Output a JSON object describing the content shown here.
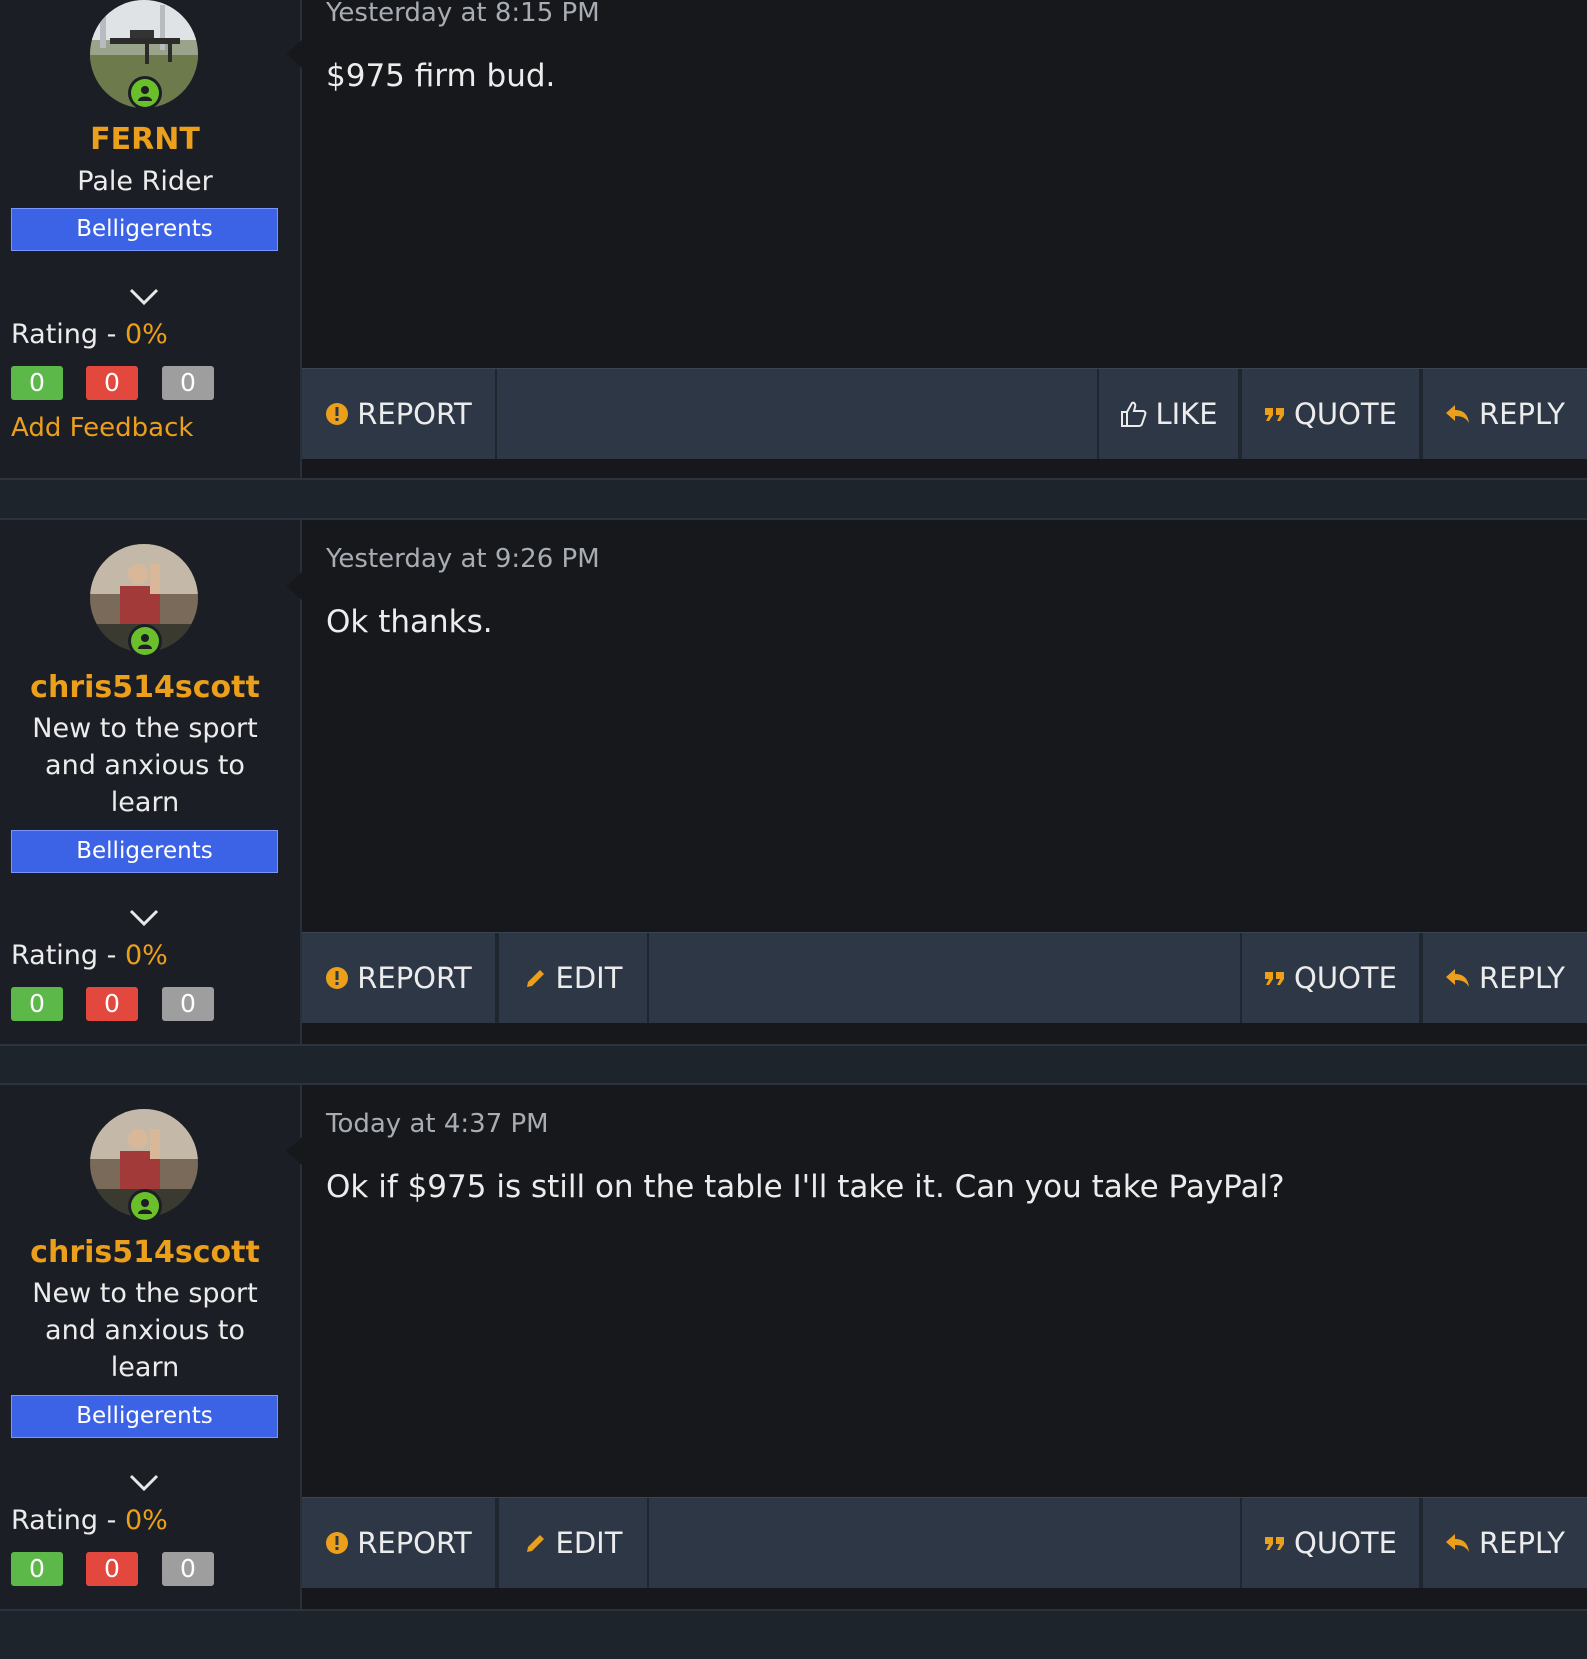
{
  "colors": {
    "accent": "#eb9f1b",
    "group_banner": "#3c63e6",
    "online": "#6bbf2a",
    "positive": "#5db84a",
    "negative": "#e2483d",
    "neutral": "#9e9e9e",
    "action_bar": "#2d3745"
  },
  "posts": [
    {
      "username": "FERNT",
      "user_title": "Pale Rider",
      "group": "Belligerents",
      "rating_label": "Rating - ",
      "rating_value": "0%",
      "feedback": {
        "positive": "0",
        "negative": "0",
        "neutral": "0"
      },
      "add_feedback": "Add Feedback",
      "date": "Yesterday at 8:15 PM",
      "message": "$975 firm bud.",
      "actions": {
        "report": "REPORT",
        "like": "LIKE",
        "quote": "QUOTE",
        "reply": "REPLY"
      }
    },
    {
      "username": "chris514scott",
      "user_title": "New to the sport and anxious to learn",
      "group": "Belligerents",
      "rating_label": "Rating - ",
      "rating_value": "0%",
      "feedback": {
        "positive": "0",
        "negative": "0",
        "neutral": "0"
      },
      "date": "Yesterday at 9:26 PM",
      "message": "Ok thanks.",
      "actions": {
        "report": "REPORT",
        "edit": "EDIT",
        "quote": "QUOTE",
        "reply": "REPLY"
      }
    },
    {
      "username": "chris514scott",
      "user_title": "New to the sport and anxious to learn",
      "group": "Belligerents",
      "rating_label": "Rating - ",
      "rating_value": "0%",
      "feedback": {
        "positive": "0",
        "negative": "0",
        "neutral": "0"
      },
      "date": "Today at 4:37 PM",
      "message": "Ok if $975 is still on the table I'll take it. Can you take PayPal?",
      "actions": {
        "report": "REPORT",
        "edit": "EDIT",
        "quote": "QUOTE",
        "reply": "REPLY"
      }
    }
  ]
}
